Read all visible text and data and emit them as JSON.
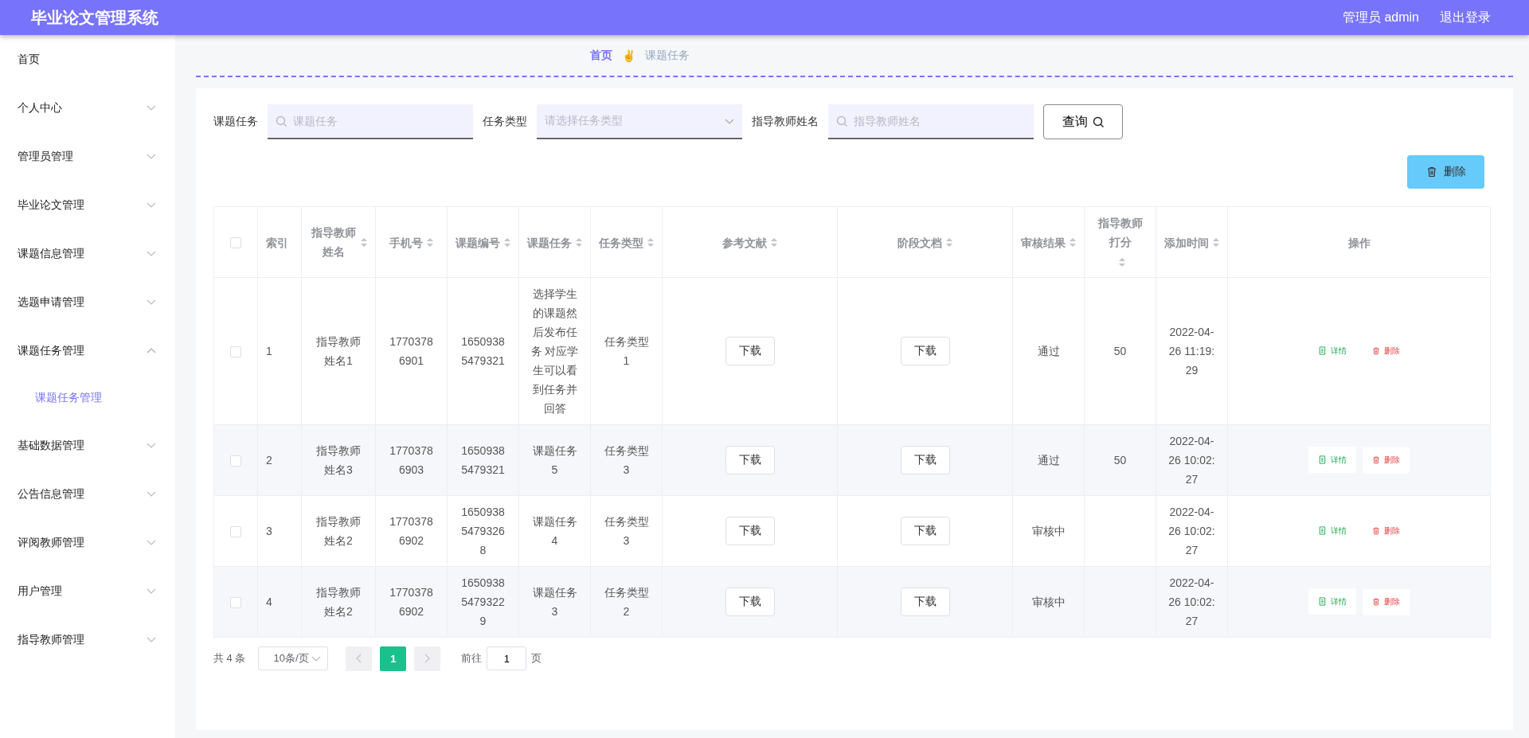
{
  "header": {
    "title": "毕业论文管理系统",
    "user": "管理员 admin",
    "logout": "退出登录"
  },
  "sidebar": {
    "items": [
      {
        "label": "首页",
        "kind": "link"
      },
      {
        "label": "个人中心",
        "kind": "menu",
        "expanded": false
      },
      {
        "label": "管理员管理",
        "kind": "menu",
        "expanded": false
      },
      {
        "label": "毕业论文管理",
        "kind": "menu",
        "expanded": false
      },
      {
        "label": "课题信息管理",
        "kind": "menu",
        "expanded": false
      },
      {
        "label": "选题申请管理",
        "kind": "menu",
        "expanded": false
      },
      {
        "label": "课题任务管理",
        "kind": "menu",
        "expanded": true,
        "children": [
          {
            "label": "课题任务管理",
            "selected": true
          }
        ]
      },
      {
        "label": "基础数据管理",
        "kind": "menu",
        "expanded": false
      },
      {
        "label": "公告信息管理",
        "kind": "menu",
        "expanded": false
      },
      {
        "label": "评阅教师管理",
        "kind": "menu",
        "expanded": false
      },
      {
        "label": "用户管理",
        "kind": "menu",
        "expanded": false
      },
      {
        "label": "指导教师管理",
        "kind": "menu",
        "expanded": false
      }
    ]
  },
  "breadcrumb": {
    "items": [
      "首页",
      "课题任务"
    ],
    "separator": "✌"
  },
  "search": {
    "fields": [
      {
        "label": "课题任务",
        "placeholder": "课题任务",
        "kind": "text"
      },
      {
        "label": "任务类型",
        "placeholder": "请选择任务类型",
        "kind": "select"
      },
      {
        "label": "指导教师姓名",
        "placeholder": "指导教师姓名",
        "kind": "text"
      }
    ],
    "button": "查询"
  },
  "toolbar": {
    "delete_button": "删除"
  },
  "table": {
    "select_all": {
      "checked": false
    },
    "columns": [
      {
        "label": "索引",
        "sortable": false
      },
      {
        "label": "指导教师姓名",
        "sortable": true
      },
      {
        "label": "手机号",
        "sortable": true
      },
      {
        "label": "课题编号",
        "sortable": true
      },
      {
        "label": "课题任务",
        "sortable": true
      },
      {
        "label": "任务类型",
        "sortable": true
      },
      {
        "label": "参考文献",
        "sortable": true
      },
      {
        "label": "阶段文档",
        "sortable": true
      },
      {
        "label": "审核结果",
        "sortable": true
      },
      {
        "label": "指导教师打分",
        "sortable": true
      },
      {
        "label": "添加时间",
        "sortable": true
      },
      {
        "label": "操作",
        "sortable": false
      }
    ],
    "rows": [
      {
        "checked": false,
        "index": "1",
        "teacher_name": "指导教师姓名1",
        "phone": "17703786901",
        "topic_no": "16509385479321",
        "task": "选择学生的课题然后发布任务 对应学生可以看到任务并回答",
        "task_type": "任务类型1",
        "reference": "下载",
        "stage_document": "下载",
        "review_result": "通过",
        "score": "50",
        "added_time": "2022-04-26 11:19:29",
        "actions": [
          "详情",
          "删除"
        ]
      },
      {
        "checked": false,
        "index": "2",
        "teacher_name": "指导教师姓名3",
        "phone": "17703786903",
        "topic_no": "16509385479321",
        "task": "课题任务5",
        "task_type": "任务类型3",
        "reference": "下载",
        "stage_document": "下载",
        "review_result": "通过",
        "score": "50",
        "added_time": "2022-04-26 10:02:27",
        "actions": [
          "详情",
          "删除"
        ]
      },
      {
        "checked": false,
        "index": "3",
        "teacher_name": "指导教师姓名2",
        "phone": "17703786902",
        "topic_no": "165093854793268",
        "task": "课题任务4",
        "task_type": "任务类型3",
        "reference": "下载",
        "stage_document": "下载",
        "review_result": "审核中",
        "added_time": "2022-04-26 10:02:27",
        "actions": [
          "详情",
          "删除"
        ]
      },
      {
        "checked": false,
        "index": "4",
        "teacher_name": "指导教师姓名2",
        "phone": "17703786902",
        "topic_no": "165093854793229",
        "task": "课题任务3",
        "task_type": "任务类型2",
        "reference": "下载",
        "stage_document": "下载",
        "review_result": "审核中",
        "added_time": "2022-04-26 10:02:27",
        "actions": [
          "详情",
          "删除"
        ]
      }
    ]
  },
  "pagination": {
    "total": "共 4 条",
    "page_size": "10条/页",
    "pages": [
      {
        "label": "1",
        "selected": true
      }
    ],
    "goto_label": "前往",
    "goto_value": "1",
    "goto_suffix": "页"
  }
}
